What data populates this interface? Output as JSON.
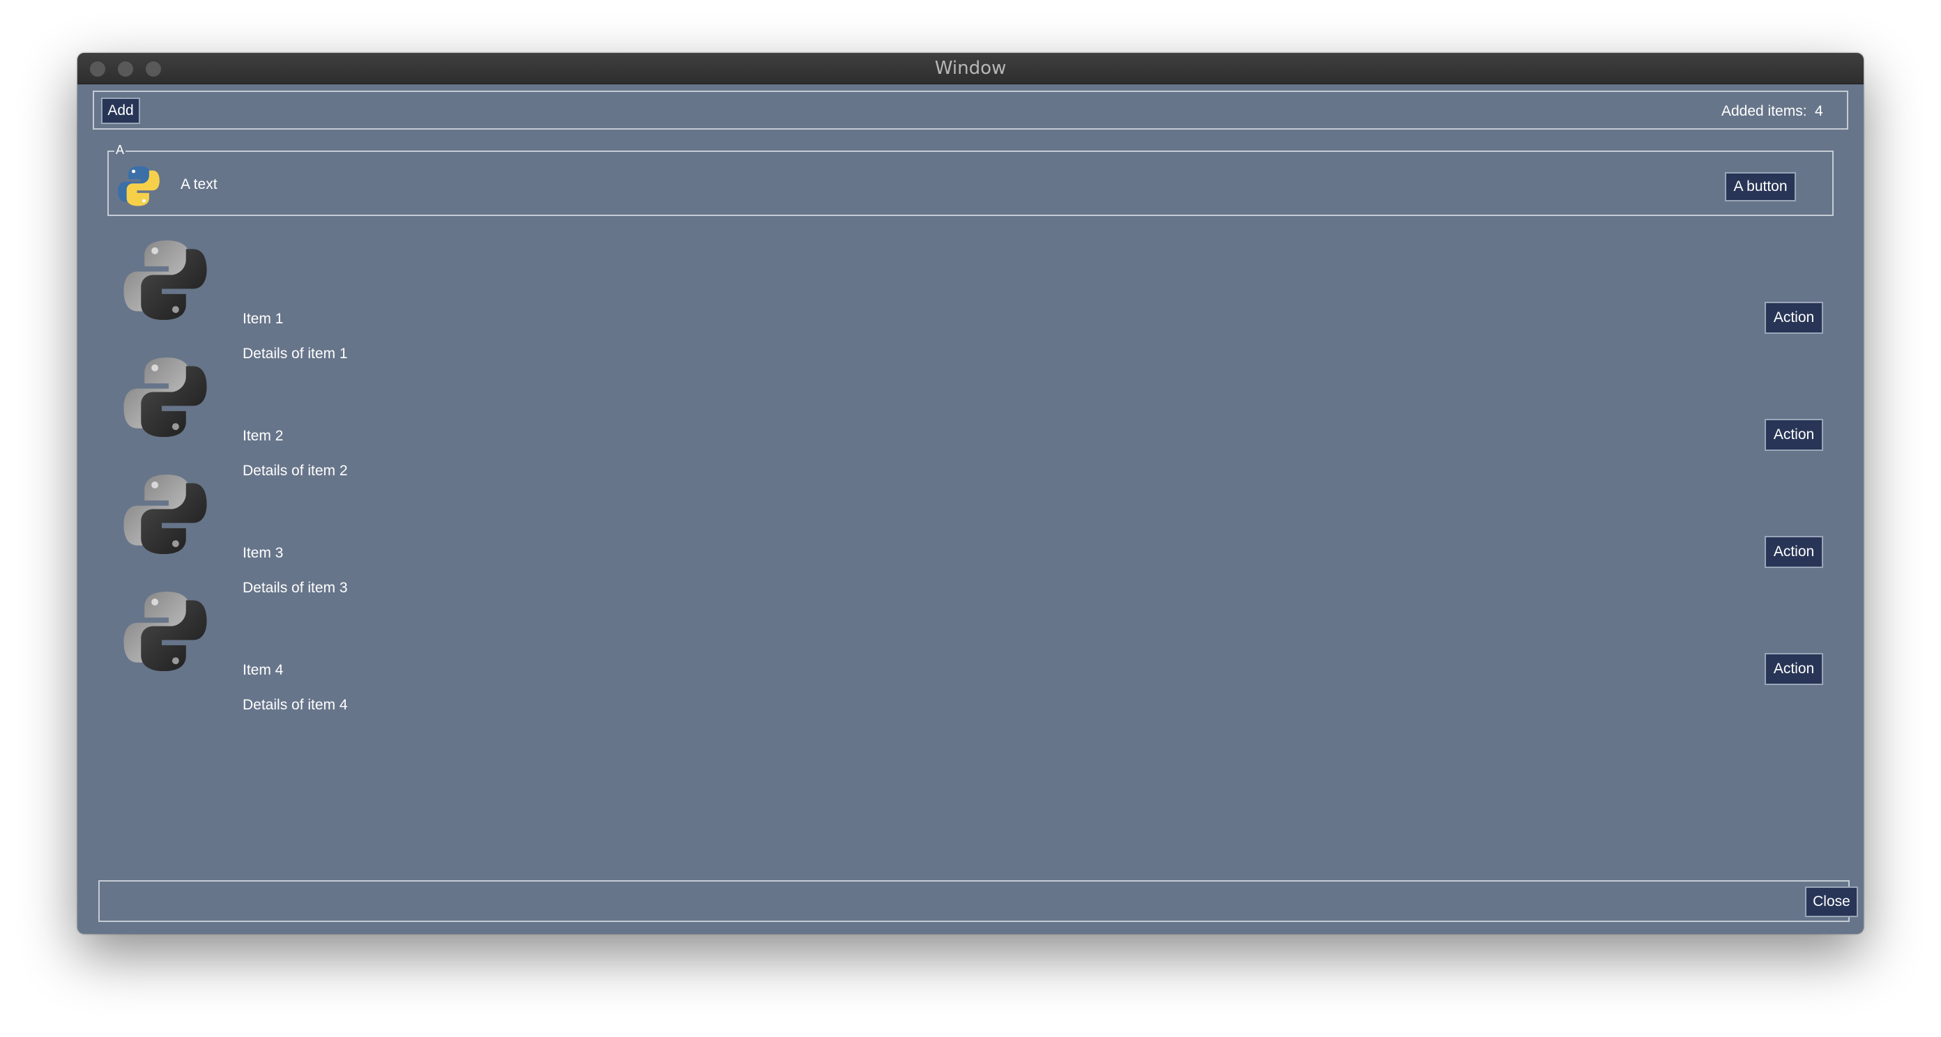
{
  "window": {
    "title": "Window"
  },
  "toolbar": {
    "add_label": "Add",
    "added_items_label": "Added items:",
    "added_items_count": "4"
  },
  "frame": {
    "legend": "A",
    "icon": "python-logo-icon",
    "text": "A text",
    "button_label": "A button"
  },
  "items": [
    {
      "icon": "python-logo-grayscale-icon",
      "title": "Item 1",
      "details": "Details of item 1",
      "action_label": "Action"
    },
    {
      "icon": "python-logo-grayscale-icon",
      "title": "Item 2",
      "details": "Details of item 2",
      "action_label": "Action"
    },
    {
      "icon": "python-logo-grayscale-icon",
      "title": "Item 3",
      "details": "Details of item 3",
      "action_label": "Action"
    },
    {
      "icon": "python-logo-grayscale-icon",
      "title": "Item 4",
      "details": "Details of item 4",
      "action_label": "Action"
    }
  ],
  "footer": {
    "close_label": "Close"
  },
  "colors": {
    "window_background": "#67758a",
    "button_background": "#283556",
    "titlebar": "#353535",
    "python_blue": "#3b6fa8",
    "python_yellow": "#f7d04a"
  }
}
